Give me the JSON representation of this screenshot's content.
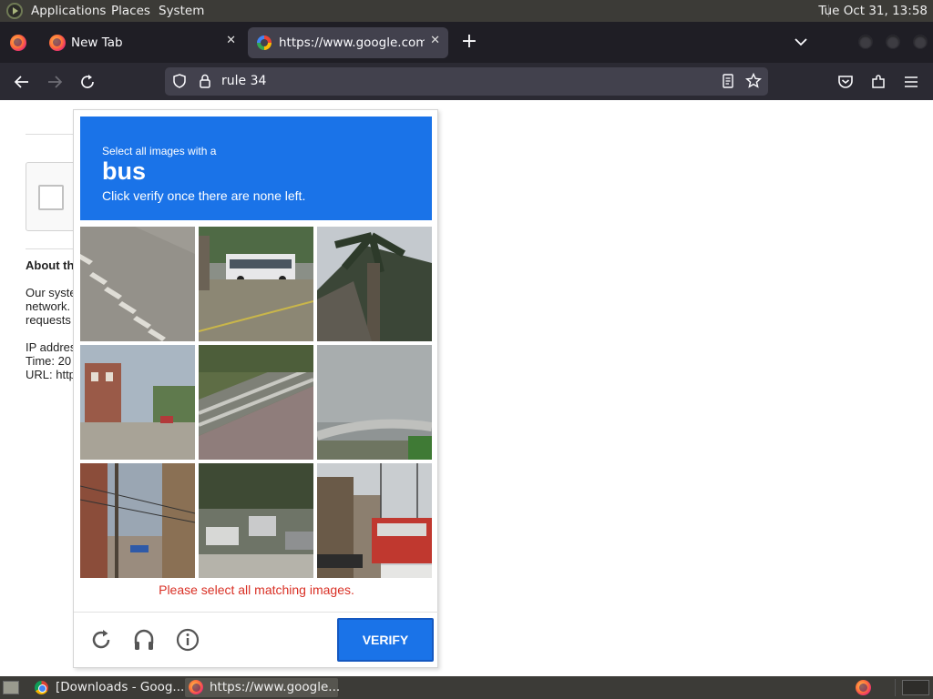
{
  "top_panel": {
    "menus": [
      "Applications",
      "Places",
      "System"
    ],
    "clock": "Tue Oct 31, 13:58"
  },
  "browser": {
    "tabs": [
      {
        "title": "New Tab",
        "icon": "firefox-icon",
        "active": false
      },
      {
        "title": "https://www.google.com/se",
        "icon": "google-icon",
        "active": true
      }
    ],
    "url": "rule 34"
  },
  "background_page": {
    "heading": "About th",
    "lines": [
      "Our syste",
      "network.",
      "requests"
    ],
    "info_lines": [
      "IP addres",
      "Time: 20",
      "URL: http"
    ]
  },
  "captcha": {
    "instruction_prefix": "Select all images with a",
    "target_word": "bus",
    "instruction_suffix": "Click verify once there are none left.",
    "tiles": [
      {
        "subject": "road-markings"
      },
      {
        "subject": "bus-on-street"
      },
      {
        "subject": "palm-tree"
      },
      {
        "subject": "town-street"
      },
      {
        "subject": "railway-track"
      },
      {
        "subject": "highway-overpass"
      },
      {
        "subject": "building-power-lines"
      },
      {
        "subject": "parked-cars"
      },
      {
        "subject": "streetcar"
      }
    ],
    "error": "Please select all matching images.",
    "verify_label": "VERIFY",
    "accent": "#1a73e8",
    "error_color": "#d93025"
  },
  "taskbar": {
    "items": [
      {
        "label": "[Downloads - Goog...",
        "icon": "chrome-icon",
        "active": false
      },
      {
        "label": "https://www.google...",
        "icon": "firefox-icon",
        "active": true
      }
    ]
  }
}
